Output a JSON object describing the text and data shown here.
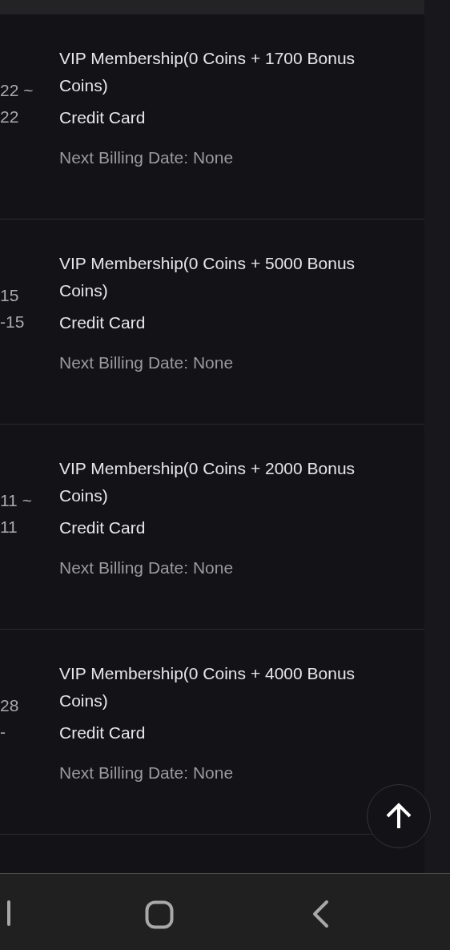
{
  "subscriptions": [
    {
      "date_lines": [
        "22 ~",
        "22"
      ],
      "title": "VIP Membership(0 Coins + 1700 Bonus Coins)",
      "payment": "Credit Card",
      "next_billing": "Next Billing Date: None"
    },
    {
      "date_lines": [
        "15",
        "-15"
      ],
      "title": "VIP Membership(0 Coins + 5000 Bonus Coins)",
      "payment": "Credit Card",
      "next_billing": "Next Billing Date: None"
    },
    {
      "date_lines": [
        "11 ~",
        "11"
      ],
      "title": "VIP Membership(0 Coins + 2000 Bonus Coins)",
      "payment": "Credit Card",
      "next_billing": "Next Billing Date: None"
    },
    {
      "date_lines": [
        "28",
        "-"
      ],
      "title": "VIP Membership(0 Coins + 4000 Bonus Coins)",
      "payment": "Credit Card",
      "next_billing": "Next Billing Date: None"
    }
  ]
}
